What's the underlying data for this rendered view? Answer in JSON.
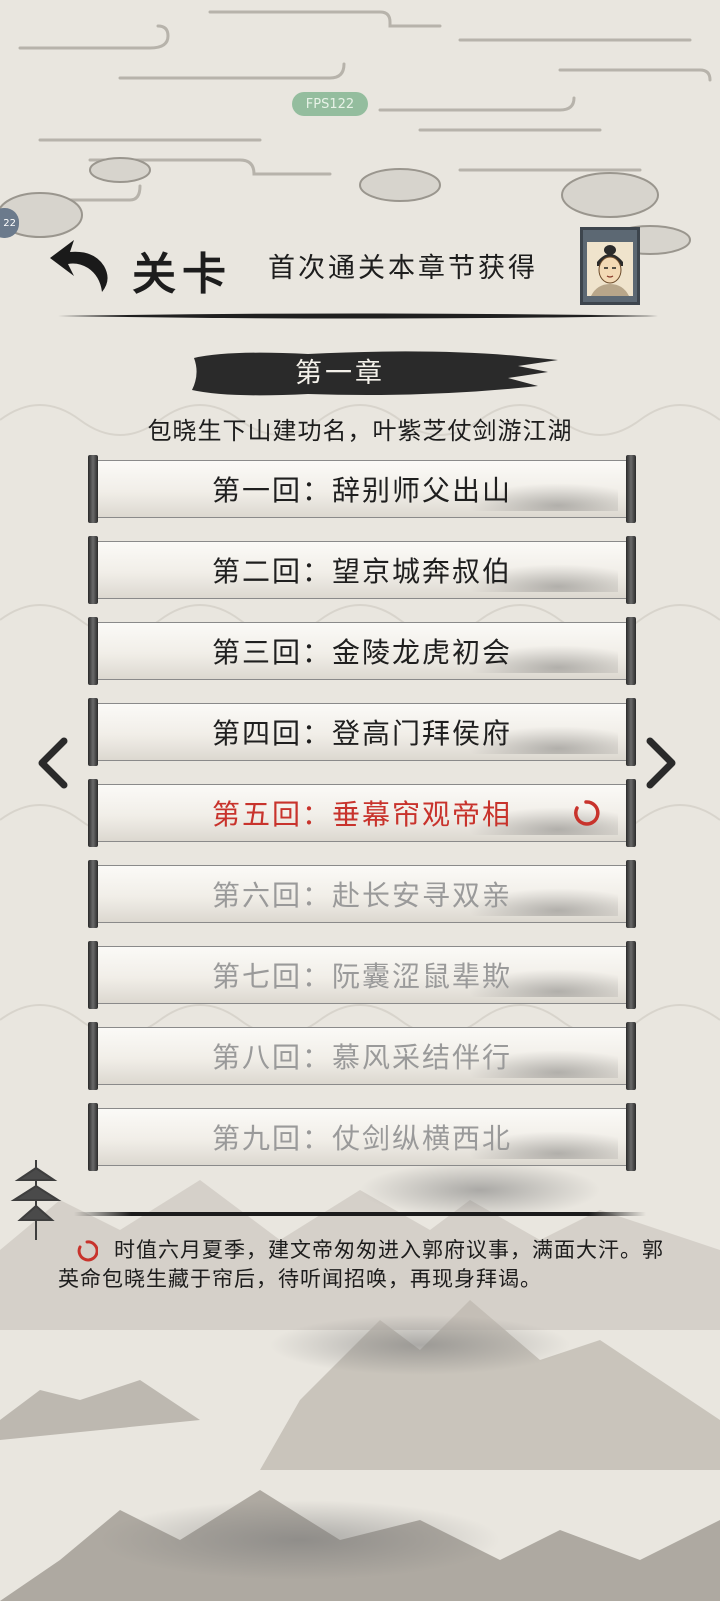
{
  "status": {
    "fps": "FPS122",
    "side_tab": "22"
  },
  "header": {
    "title": "关卡",
    "reward_text": "首次通关本章节获得",
    "reward_avatar": "avatar-portrait-icon"
  },
  "chapter": {
    "title": "第一章",
    "subtitle": "包晓生下山建功名，叶紫芝仗剑游江湖"
  },
  "levels": [
    {
      "label": "第一回：辞别师父出山",
      "state": "done"
    },
    {
      "label": "第二回：望京城奔叔伯",
      "state": "done"
    },
    {
      "label": "第三回：金陵龙虎初会",
      "state": "done"
    },
    {
      "label": "第四回：登高门拜侯府",
      "state": "done"
    },
    {
      "label": "第五回：垂幕帘观帝相",
      "state": "current"
    },
    {
      "label": "第六回：赴长安寻双亲",
      "state": "locked"
    },
    {
      "label": "第七回：阮囊涩鼠辈欺",
      "state": "locked"
    },
    {
      "label": "第八回：慕风采结伴行",
      "state": "locked"
    },
    {
      "label": "第九回：仗剑纵横西北",
      "state": "locked"
    }
  ],
  "description": "时值六月夏季，建文帝匆匆进入郭府议事，满面大汗。郭英命包晓生藏于帘后，待听闻招唤，再现身拜谒。",
  "colors": {
    "current": "#c8332c",
    "locked": "#9a9a9a",
    "done": "#1f1f1f",
    "background": "#e9e6df"
  }
}
